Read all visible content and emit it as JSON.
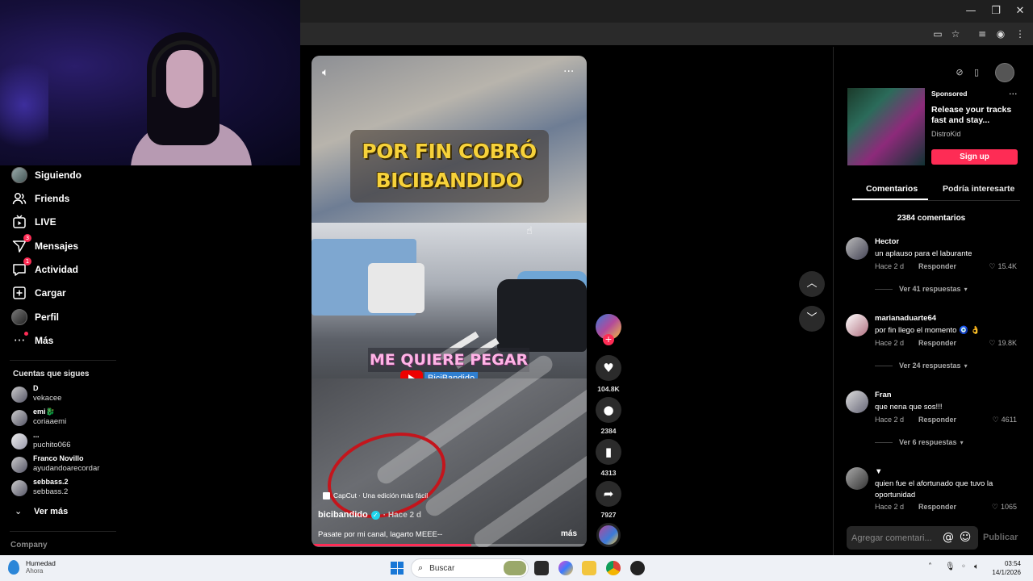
{
  "window_controls": {
    "minimize": "—",
    "maximize": "❐",
    "close": "✕"
  },
  "sidebar": {
    "items": [
      {
        "label": "Siguiendo",
        "icon": "following-avatar-icon"
      },
      {
        "label": "Friends",
        "icon": "friends-icon"
      },
      {
        "label": "LIVE",
        "icon": "live-icon"
      },
      {
        "label": "Mensajes",
        "icon": "messages-icon",
        "badge": "3"
      },
      {
        "label": "Actividad",
        "icon": "activity-icon",
        "badge": "1"
      },
      {
        "label": "Cargar",
        "icon": "upload-icon"
      },
      {
        "label": "Perfil",
        "icon": "profile-avatar-icon"
      },
      {
        "label": "Más",
        "icon": "more-icon"
      }
    ],
    "following_title": "Cuentas que sigues",
    "following": [
      {
        "name": "D",
        "handle": "vekacee"
      },
      {
        "name": "emi🐉",
        "handle": "coriaaemi"
      },
      {
        "name": "...",
        "handle": "puchito066"
      },
      {
        "name": "Franco Novillo",
        "handle": "ayudandoarecordar"
      },
      {
        "name": "sebbass.2",
        "handle": "sebbass.2"
      }
    ],
    "see_more": "Ver más",
    "company": "Company"
  },
  "video": {
    "caption_line1": "POR FIN COBRÓ",
    "caption_line2": "BICIBANDIDO",
    "pink_caption": "ME QUIERE PEGAR",
    "yt_channel": "BiciBandido",
    "capcut": "CapCut · Una edición más fácil",
    "author": "bicibandido",
    "posted": "· Hace 2 d",
    "description": "Pasate por mi canal, lagarto MEEE--",
    "more": "más",
    "progress": 0.58
  },
  "actions": {
    "likes": "104.8K",
    "comments": "2384",
    "saves": "4313",
    "shares": "7927"
  },
  "ad": {
    "sponsored": "Sponsored",
    "title": "Release your tracks fast and stay...",
    "brand": "DistroKid",
    "button": "Sign up"
  },
  "tabs": {
    "comments": "Comentarios",
    "related": "Podría interesarte"
  },
  "comment_count": "2384 comentarios",
  "comments": [
    {
      "user": "Hector",
      "text": "un aplauso para el laburante",
      "time": "Hace 2 d",
      "reply": "Responder",
      "likes": "15.4K",
      "replies": "Ver 41 respuestas"
    },
    {
      "user": "marianaduarte64",
      "text": "por fin llego el momento 🧿 👌",
      "time": "Hace 2 d",
      "reply": "Responder",
      "likes": "19.8K",
      "replies": "Ver 24 respuestas"
    },
    {
      "user": "Fran",
      "text": "que nena que sos!!!",
      "time": "Hace 2 d",
      "reply": "Responder",
      "likes": "4611",
      "replies": "Ver 6 respuestas"
    },
    {
      "user": "▼",
      "text": "quien fue el afortunado que tuvo la oportunidad",
      "time": "Hace 2 d",
      "reply": "Responder",
      "likes": "1065",
      "replies": ""
    }
  ],
  "comment_input": {
    "placeholder": "Agregar comentari...",
    "publish": "Publicar"
  },
  "taskbar": {
    "weather_title": "Humedad",
    "weather_sub": "Ahora",
    "search_placeholder": "Buscar",
    "time": "03:54",
    "date": "14/1/2026"
  }
}
